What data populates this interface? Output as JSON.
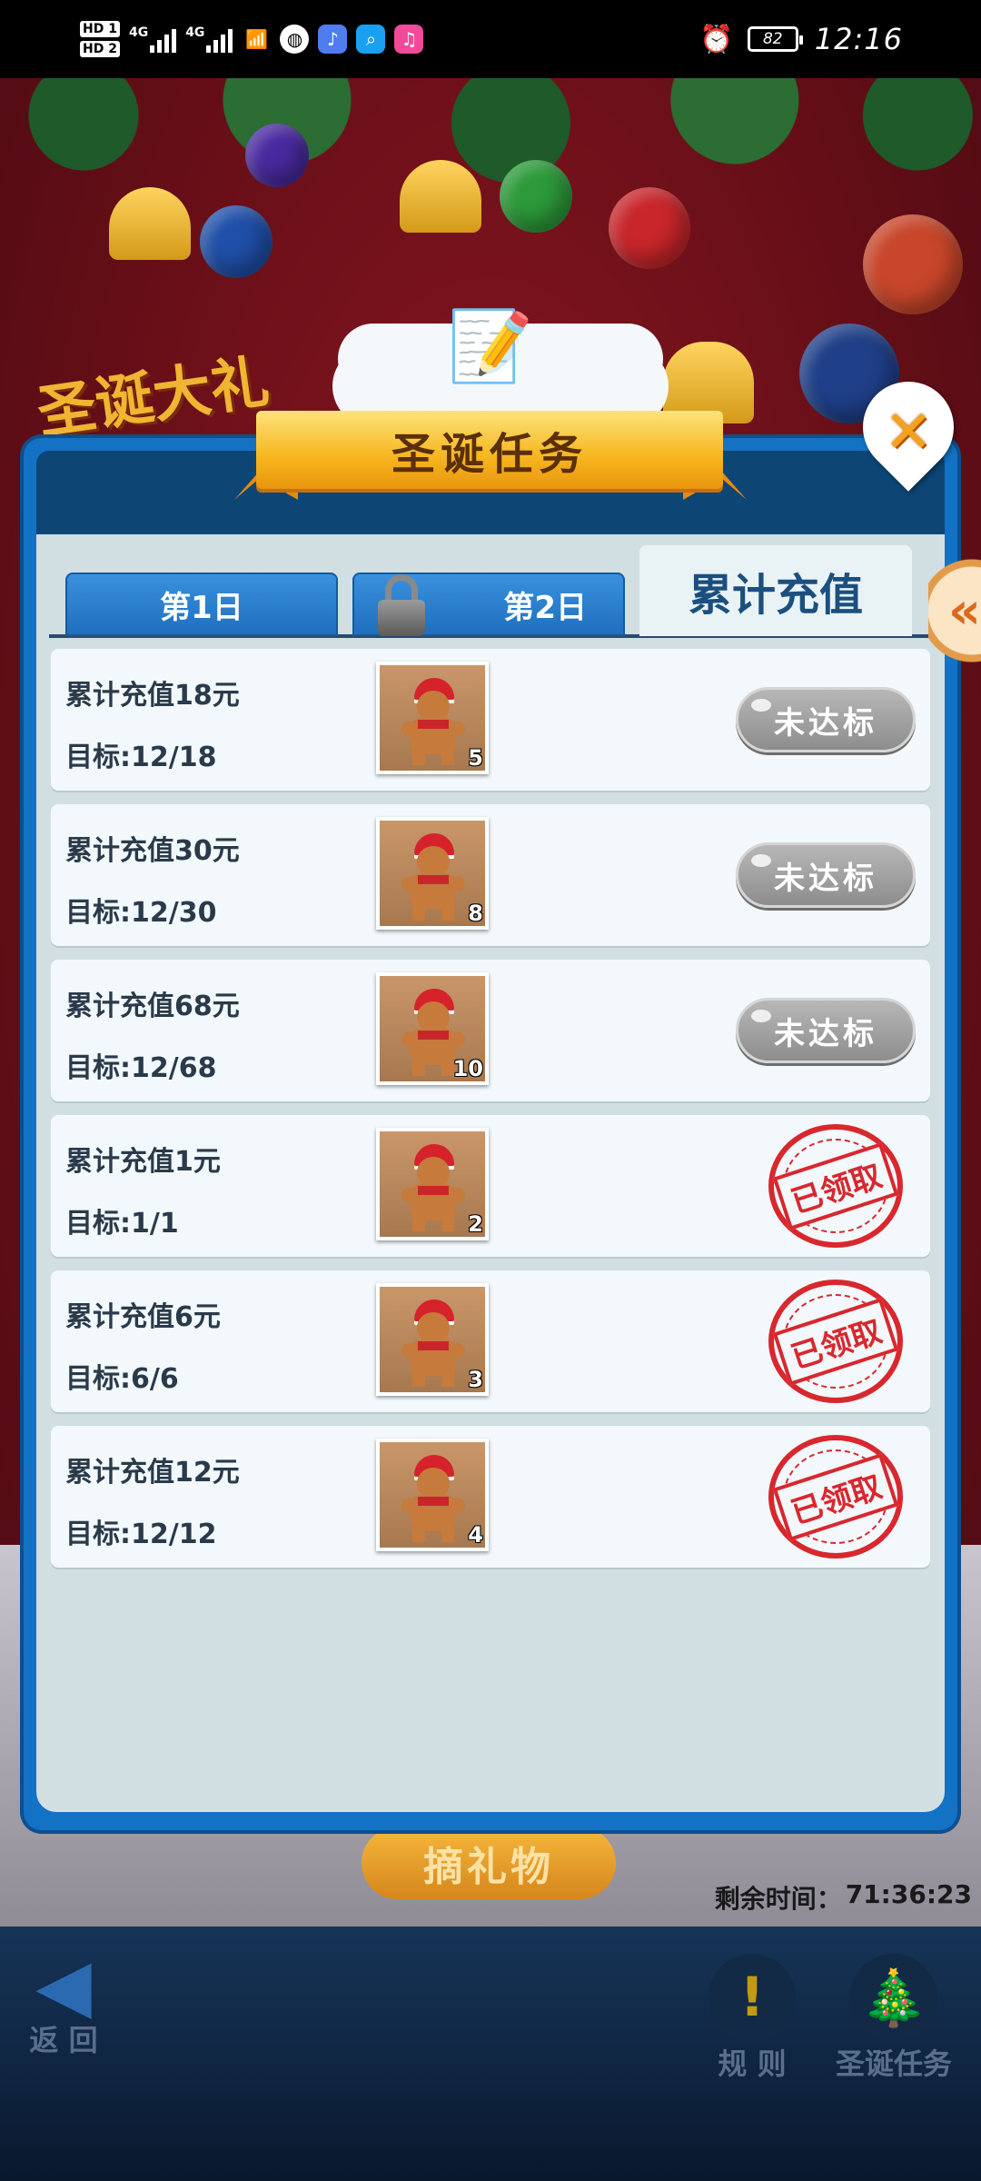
{
  "status_bar": {
    "hd1": "HD 1",
    "hd2": "HD 2",
    "net1": "4G",
    "net2": "4G",
    "battery": "82",
    "time": "12:16"
  },
  "background": {
    "title": "圣诞大礼",
    "pick_button": "摘礼物",
    "remaining_label": "剩余时间：",
    "remaining_value": "71:36:23"
  },
  "panel": {
    "title": "圣诞任务",
    "close_icon": "close-icon"
  },
  "tabs": [
    {
      "label": "第1日",
      "locked": false
    },
    {
      "label": "第2日",
      "locked": true
    },
    {
      "label": "累计充值",
      "active": true
    }
  ],
  "tasks": [
    {
      "title": "累计充值18元",
      "goal": "目标:12/18",
      "reward_count": "5",
      "status": "未达标",
      "claimed": false
    },
    {
      "title": "累计充值30元",
      "goal": "目标:12/30",
      "reward_count": "8",
      "status": "未达标",
      "claimed": false
    },
    {
      "title": "累计充值68元",
      "goal": "目标:12/68",
      "reward_count": "10",
      "status": "未达标",
      "claimed": false
    },
    {
      "title": "累计充值1元",
      "goal": "目标:1/1",
      "reward_count": "2",
      "status": "已领取",
      "claimed": true
    },
    {
      "title": "累计充值6元",
      "goal": "目标:6/6",
      "reward_count": "3",
      "status": "已领取",
      "claimed": true
    },
    {
      "title": "累计充值12元",
      "goal": "目标:12/12",
      "reward_count": "4",
      "status": "已领取",
      "claimed": true
    }
  ],
  "bottom_bar": {
    "back": "返 回",
    "rules": "规 则",
    "christmas_tasks": "圣诞任务"
  },
  "side_arrow": "«"
}
